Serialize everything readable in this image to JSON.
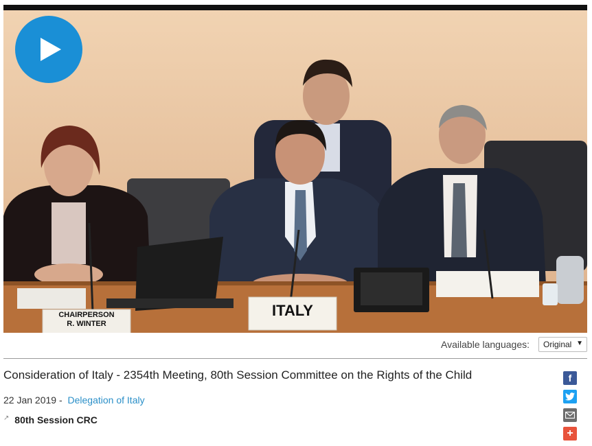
{
  "video": {
    "play_icon": "play-icon",
    "nameplate_chair_line1": "CHAIRPERSON",
    "nameplate_chair_line2": "R. WINTER",
    "nameplate_country": "ITALY"
  },
  "languages": {
    "label": "Available languages:",
    "selected": "Original",
    "caret": "▼"
  },
  "meeting": {
    "title": "Consideration of Italy - 2354th Meeting, 80th Session Committee on the Rights of the Child",
    "date": "22 Jan 2019 -",
    "delegation_link": "Delegation of Italy",
    "session_icon": "external-link-icon",
    "session_label": "80th Session CRC"
  },
  "share": {
    "facebook": "f",
    "plus": "+"
  },
  "colors": {
    "play_button": "#1a8fd6",
    "link": "#2a8fc8",
    "facebook": "#3b5998",
    "twitter": "#1da1f2",
    "mail": "#6d6d6d",
    "plus": "#e8533b"
  }
}
